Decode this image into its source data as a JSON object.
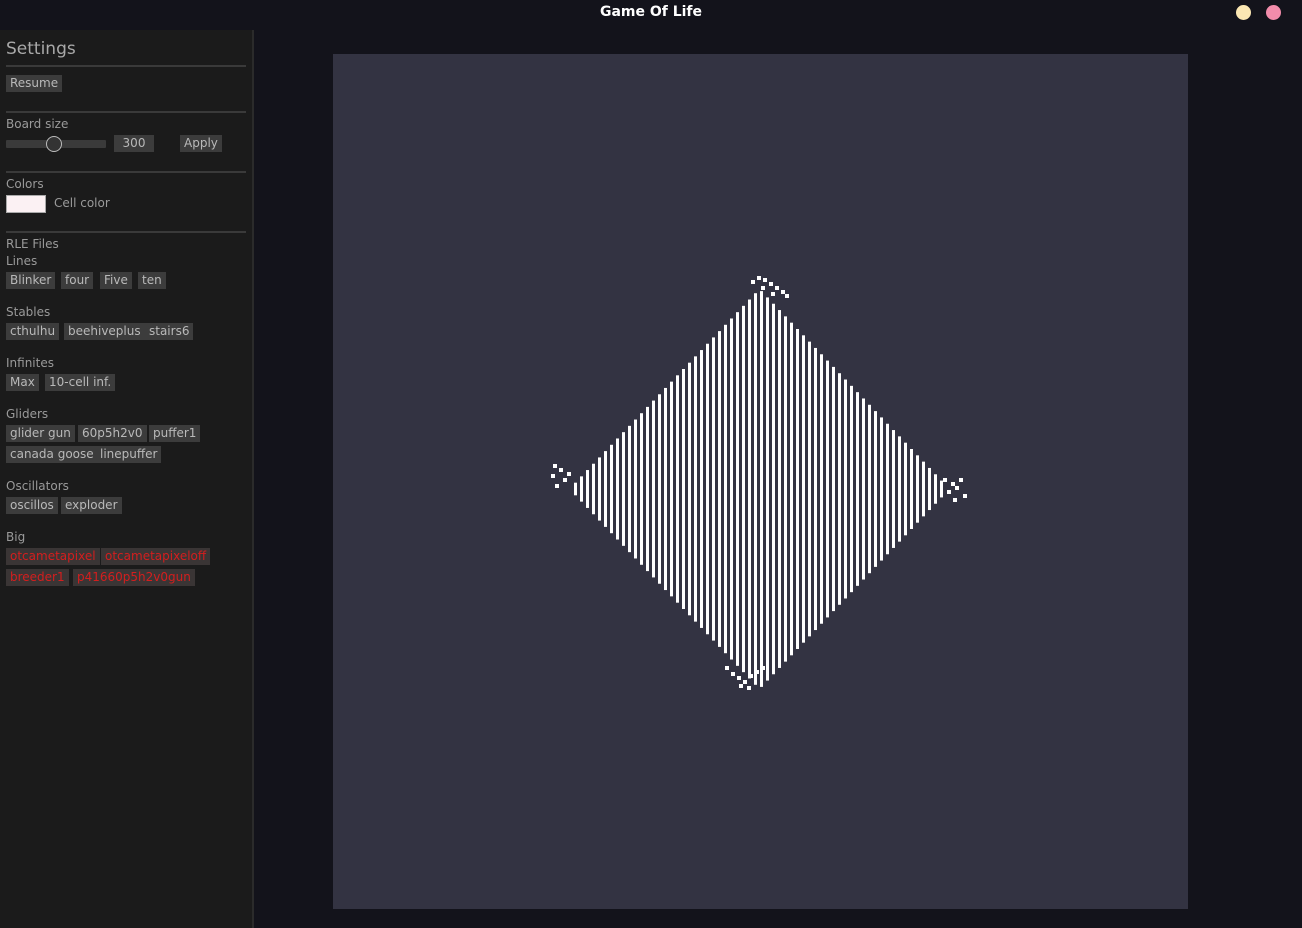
{
  "window": {
    "title": "Game Of Life"
  },
  "settings": {
    "heading": "Settings",
    "resume_label": "Resume",
    "board_size": {
      "label": "Board size",
      "value": "300",
      "apply_label": "Apply"
    },
    "colors": {
      "label": "Colors",
      "cell_color_label": "Cell color",
      "cell_color": "#fbf1f3"
    },
    "rle": {
      "label": "RLE Files",
      "groups": [
        {
          "label": "Lines",
          "items": [
            "Blinker",
            "four",
            "Five",
            "ten"
          ]
        },
        {
          "label": "Stables",
          "items": [
            "cthulhu",
            "beehiveplus",
            "stairs6"
          ]
        },
        {
          "label": "Infinites",
          "items": [
            "Max",
            "10-cell inf."
          ]
        },
        {
          "label": "Gliders",
          "items": [
            "glider gun",
            "60p5h2v0",
            "puffer1",
            "canada goose",
            "linepuffer"
          ]
        },
        {
          "label": "Oscillators",
          "items": [
            "oscillos",
            "exploder"
          ]
        },
        {
          "label": "Big",
          "items": [
            "otcametapixel",
            "otcametapixeloff",
            "breeder1",
            "p41660p5h2v0gun"
          ]
        }
      ]
    }
  },
  "colors": {
    "background": "#13131b",
    "sidebar": "#1b1b1b",
    "board": "#333342",
    "cell": "#ffffff",
    "big_button_text": "#d41e1e"
  }
}
